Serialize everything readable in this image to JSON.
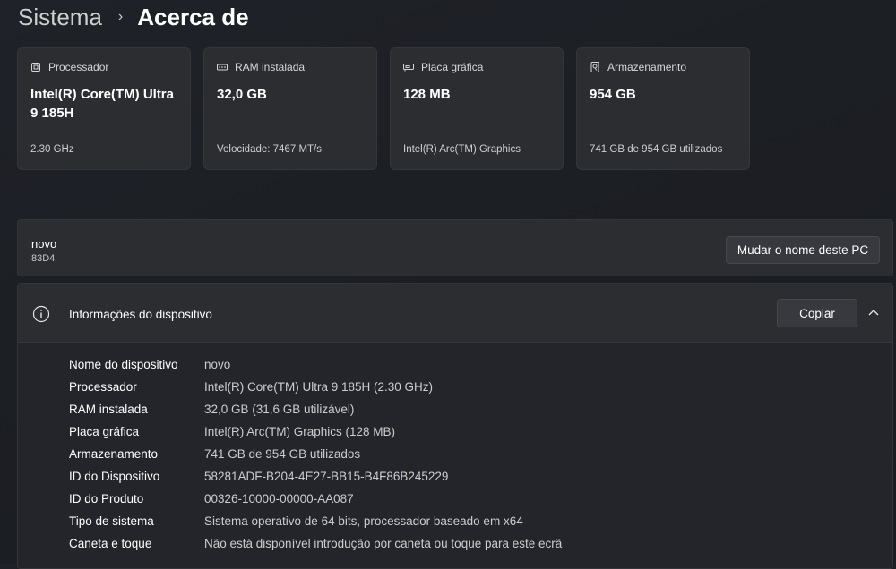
{
  "breadcrumb": {
    "parent": "Sistema",
    "separator": "›",
    "current": "Acerca de"
  },
  "specs": [
    {
      "label": "Processador",
      "value": "Intel(R) Core(TM) Ultra 9 185H",
      "sub": "2.30 GHz",
      "icon": "processor-icon"
    },
    {
      "label": "RAM instalada",
      "value": "32,0 GB",
      "sub": "Velocidade: 7467 MT/s",
      "icon": "ram-icon"
    },
    {
      "label": "Placa gráfica",
      "value": "128 MB",
      "sub": "Intel(R) Arc(TM) Graphics",
      "icon": "graphics-card-icon"
    },
    {
      "label": "Armazenamento",
      "value": "954 GB",
      "sub": "741 GB de 954 GB utilizados",
      "icon": "storage-icon"
    }
  ],
  "device": {
    "name": "novo",
    "model": "83D4",
    "rename_label": "Mudar o nome deste PC"
  },
  "info": {
    "title": "Informações do dispositivo",
    "copy_label": "Copiar",
    "rows": [
      {
        "k": "Nome do dispositivo",
        "v": "novo"
      },
      {
        "k": "Processador",
        "v": "Intel(R) Core(TM) Ultra 9 185H (2.30 GHz)"
      },
      {
        "k": "RAM instalada",
        "v": "32,0 GB (31,6 GB utilizável)"
      },
      {
        "k": "Placa gráfica",
        "v": "Intel(R) Arc(TM) Graphics (128 MB)"
      },
      {
        "k": "Armazenamento",
        "v": "741 GB de 954 GB utilizados"
      },
      {
        "k": "ID do Dispositivo",
        "v": "58281ADF-B204-4E27-BB15-B4F86B245229"
      },
      {
        "k": "ID do Produto",
        "v": "00326-10000-00000-AA087"
      },
      {
        "k": "Tipo de sistema",
        "v": "Sistema operativo de 64 bits, processador baseado em x64"
      },
      {
        "k": "Caneta e toque",
        "v": "Não está disponível introdução por caneta ou toque para este ecrã"
      }
    ]
  }
}
